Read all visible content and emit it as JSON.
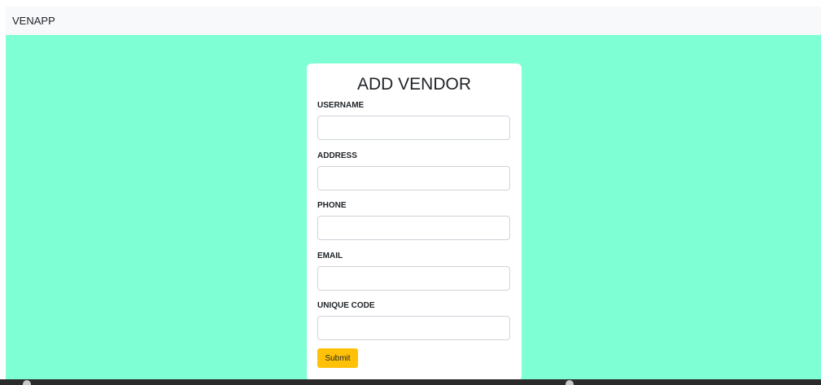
{
  "navbar": {
    "brand": "VENAPP"
  },
  "form": {
    "title": "ADD VENDOR",
    "fields": [
      {
        "label": "USERNAME",
        "value": "",
        "placeholder": ""
      },
      {
        "label": "ADDRESS",
        "value": "",
        "placeholder": ""
      },
      {
        "label": "PHONE",
        "value": "",
        "placeholder": ""
      },
      {
        "label": "EMAIL",
        "value": "",
        "placeholder": ""
      },
      {
        "label": "UNIQUE CODE",
        "value": "",
        "placeholder": ""
      }
    ],
    "submit_label": "Submit"
  },
  "colors": {
    "background": "#7fffd4",
    "navbar": "#f8f9fa",
    "submit_button": "#ffc107"
  }
}
